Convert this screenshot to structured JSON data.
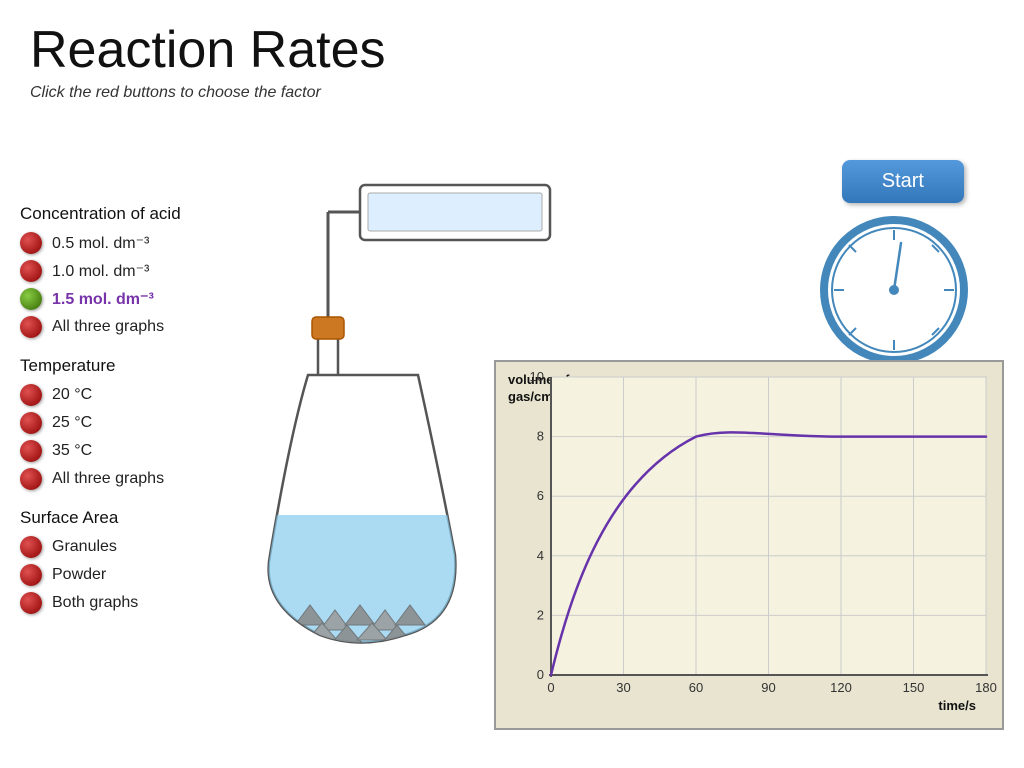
{
  "title": "Reaction Rates",
  "subtitle": "Click the red buttons to choose the factor",
  "start_button": "Start",
  "sections": [
    {
      "id": "concentration",
      "title": "Concentration of acid",
      "options": [
        {
          "id": "conc-05",
          "label": "0.5 mol. dm⁻³",
          "dot": "red",
          "selected": false
        },
        {
          "id": "conc-10",
          "label": "1.0 mol. dm⁻³",
          "dot": "red",
          "selected": false
        },
        {
          "id": "conc-15",
          "label": "1.5 mol. dm⁻³",
          "dot": "green",
          "selected": true
        },
        {
          "id": "conc-all",
          "label": "All three graphs",
          "dot": "red",
          "selected": false
        }
      ]
    },
    {
      "id": "temperature",
      "title": "Temperature",
      "options": [
        {
          "id": "temp-20",
          "label": "20 °C",
          "dot": "red",
          "selected": false
        },
        {
          "id": "temp-25",
          "label": "25 °C",
          "dot": "red",
          "selected": false
        },
        {
          "id": "temp-35",
          "label": "35 °C",
          "dot": "red",
          "selected": false
        },
        {
          "id": "temp-all",
          "label": "All three graphs",
          "dot": "red",
          "selected": false
        }
      ]
    },
    {
      "id": "surface",
      "title": "Surface Area",
      "options": [
        {
          "id": "surf-gran",
          "label": "Granules",
          "dot": "red",
          "selected": false
        },
        {
          "id": "surf-pow",
          "label": "Powder",
          "dot": "red",
          "selected": false
        },
        {
          "id": "surf-both",
          "label": "Both graphs",
          "dot": "red",
          "selected": false
        }
      ]
    }
  ],
  "graph": {
    "y_label": "volume of\ngas/cm³",
    "x_label": "time/s",
    "y_ticks": [
      0,
      2,
      4,
      6,
      8,
      10
    ],
    "x_ticks": [
      0,
      30,
      60,
      90,
      120,
      150,
      180
    ]
  }
}
